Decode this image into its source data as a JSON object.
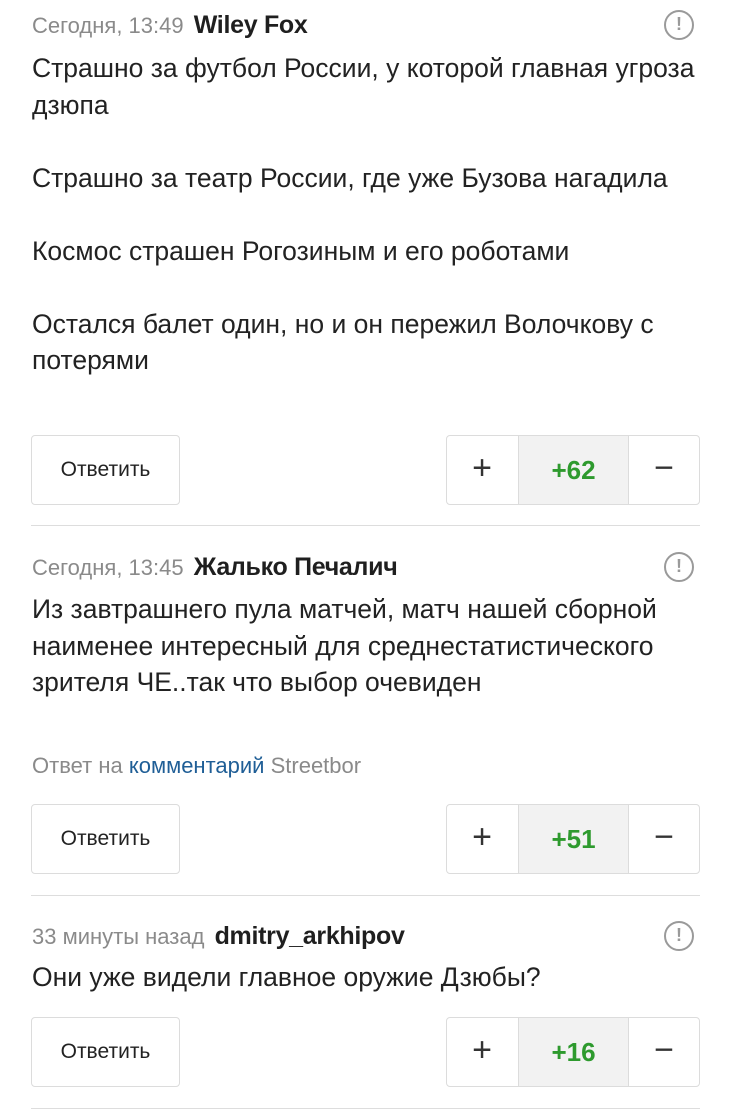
{
  "ui": {
    "reply_label": "Ответить",
    "plus_symbol": "+",
    "minus_symbol": "−",
    "report_symbol": "!"
  },
  "colors": {
    "score_positive": "#2e9a2e",
    "link": "#1f5e96",
    "meta_gray": "#8a8a8a"
  },
  "comments": [
    {
      "time": "Сегодня, 13:49",
      "author": "Wiley Fox",
      "text": "Страшно за футбол России, у которой главная угроза дзюпа\n\nСтрашно за театр России, где уже Бузова нагадила\n\nКосмос страшен Рогозиным и его роботами\n\nОстался балет один, но и он пережил Волочкову с потерями",
      "score": "+62"
    },
    {
      "time": "Сегодня, 13:45",
      "author": "Жалько Печалич",
      "text": "Из завтрашнего пула матчей, матч нашей сборной наименее интересный для среднестатистического зрителя ЧЕ..так что выбор очевиден",
      "reply_prefix": "Ответ на",
      "reply_link": "комментарий",
      "reply_user": "Streetbor",
      "score": "+51"
    },
    {
      "time": "33 минуты назад",
      "author": "dmitry_arkhipov",
      "text": "Они уже видели главное оружие Дзюбы?",
      "score": "+16"
    }
  ]
}
